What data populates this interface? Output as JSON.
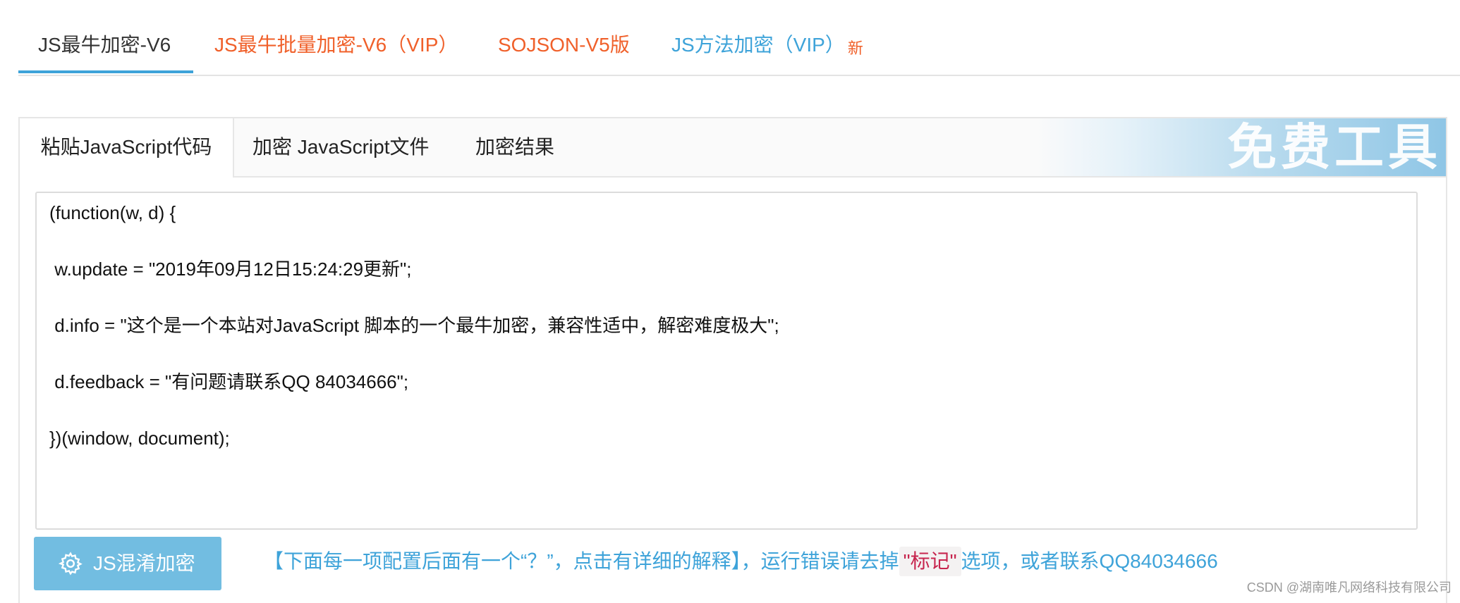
{
  "top_tabs": [
    {
      "label": "JS最牛加密-V6",
      "color": "#333333",
      "active": true
    },
    {
      "label": "JS最牛批量加密-V6（VIP）",
      "color": "#f0602a"
    },
    {
      "label": "SOJSON-V5版",
      "color": "#f0602a"
    },
    {
      "label": "JS方法加密（VIP）",
      "color": "#3ea3d9",
      "badge": "新",
      "badge_color": "#f0602a"
    }
  ],
  "inner_tabs": [
    {
      "label": "粘贴JavaScript代码",
      "active": true
    },
    {
      "label": "加密 JavaScript文件"
    },
    {
      "label": "加密结果"
    }
  ],
  "banner_text": "免费工具",
  "code_lines": [
    "(function(w, d) {",
    " w.update = \"2019年09月12日15:24:29更新\";",
    " d.info = \"这个是一个本站对JavaScript 脚本的一个最牛加密，兼容性适中，解密难度极大\";",
    " d.feedback = \"有问题请联系QQ 84034666\";",
    "})(window, document);"
  ],
  "encrypt_button": {
    "label": "JS混淆加密",
    "icon": "gear-icon",
    "color": "#72bde1"
  },
  "hint": {
    "before": "【下面每一项配置后面有一个“？”，点击有详细的解释】，运行错误请去掉",
    "mark": "\"标记\"",
    "after": "选项，或者联系QQ84034666"
  },
  "watermark": "CSDN @湖南唯凡网络科技有限公司",
  "accent_color": "#3ea3d9"
}
